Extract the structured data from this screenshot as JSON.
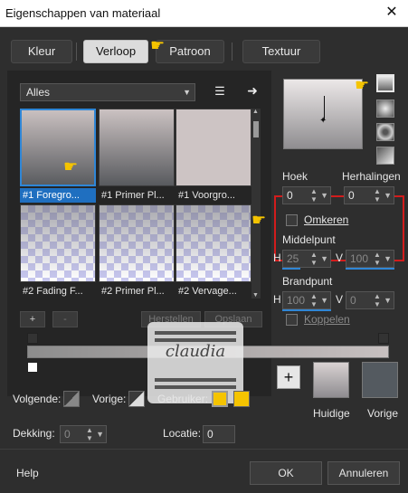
{
  "window": {
    "title": "Eigenschappen van materiaal",
    "close_label": "✕"
  },
  "tabs": [
    {
      "label": "Kleur",
      "active": false
    },
    {
      "label": "Verloop",
      "active": true
    },
    {
      "label": "Patroon",
      "active": false
    },
    {
      "label": "Textuur",
      "active": false
    }
  ],
  "gradient_list": {
    "category": "Alles",
    "items": [
      {
        "label": "#1 Foregro...",
        "selected": true
      },
      {
        "label": "#1 Primer Pl..."
      },
      {
        "label": "#1 Voorgro..."
      },
      {
        "label": "#2 Fading F..."
      },
      {
        "label": "#2 Primer Pl..."
      },
      {
        "label": "#2 Vervage..."
      }
    ]
  },
  "gradient_editor": {
    "add": "+",
    "remove": "-",
    "restore": "Herstellen",
    "save": "Opslaan"
  },
  "properties": {
    "angle_label": "Hoek",
    "angle_value": "0",
    "repeats_label": "Herhalingen",
    "repeats_value": "0",
    "invert_label": "Omkeren",
    "center_label": "Middelpunt",
    "center_h_label": "H",
    "center_h_value": "25",
    "center_v_label": "V",
    "center_v_value": "100",
    "focal_label": "Brandpunt",
    "focal_h_label": "H",
    "focal_h_value": "100",
    "focal_v_label": "V",
    "focal_v_value": "0",
    "link_label": "Koppelen"
  },
  "stop_controls": {
    "next_label": "Volgende:",
    "prev_label": "Vorige:",
    "user_label": "Gebruiker:",
    "opacity_label": "Dekking:",
    "opacity_value": "0",
    "location_label": "Locatie:",
    "location_value": "0"
  },
  "swatches": {
    "add": "+",
    "current_label": "Huidige",
    "previous_label": "Vorige"
  },
  "watermark_text": "claudia",
  "footer": {
    "help": "Help",
    "ok": "OK",
    "cancel": "Annuleren"
  },
  "colors": {
    "accent_blue": "#2f86d6",
    "highlight_red": "#d21c1c",
    "user_yellow": "#f5c400",
    "current_swatch": "#b6aeb0",
    "previous_swatch": "#545a60"
  }
}
